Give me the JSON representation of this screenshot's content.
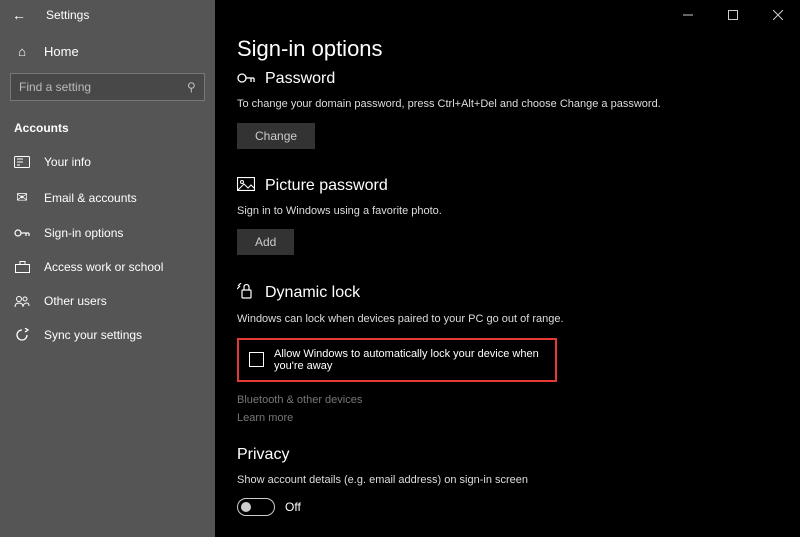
{
  "window": {
    "title": "Settings"
  },
  "sidebar": {
    "home": "Home",
    "searchPlaceholder": "Find a setting",
    "category": "Accounts",
    "items": [
      {
        "label": "Your info"
      },
      {
        "label": "Email & accounts"
      },
      {
        "label": "Sign-in options"
      },
      {
        "label": "Access work or school"
      },
      {
        "label": "Other users"
      },
      {
        "label": "Sync your settings"
      }
    ]
  },
  "page": {
    "title": "Sign-in options"
  },
  "password": {
    "heading": "Password",
    "desc": "To change your domain password, press Ctrl+Alt+Del and choose Change a password.",
    "button": "Change"
  },
  "picture": {
    "heading": "Picture password",
    "desc": "Sign in to Windows using a favorite photo.",
    "button": "Add"
  },
  "dynamic": {
    "heading": "Dynamic lock",
    "desc": "Windows can lock when devices paired to your PC go out of range.",
    "checkboxLabel": "Allow Windows to automatically lock your device when you're away",
    "link1": "Bluetooth & other devices",
    "link2": "Learn more"
  },
  "privacy": {
    "heading": "Privacy",
    "desc": "Show account details (e.g. email address) on sign-in screen",
    "toggleState": "Off"
  }
}
